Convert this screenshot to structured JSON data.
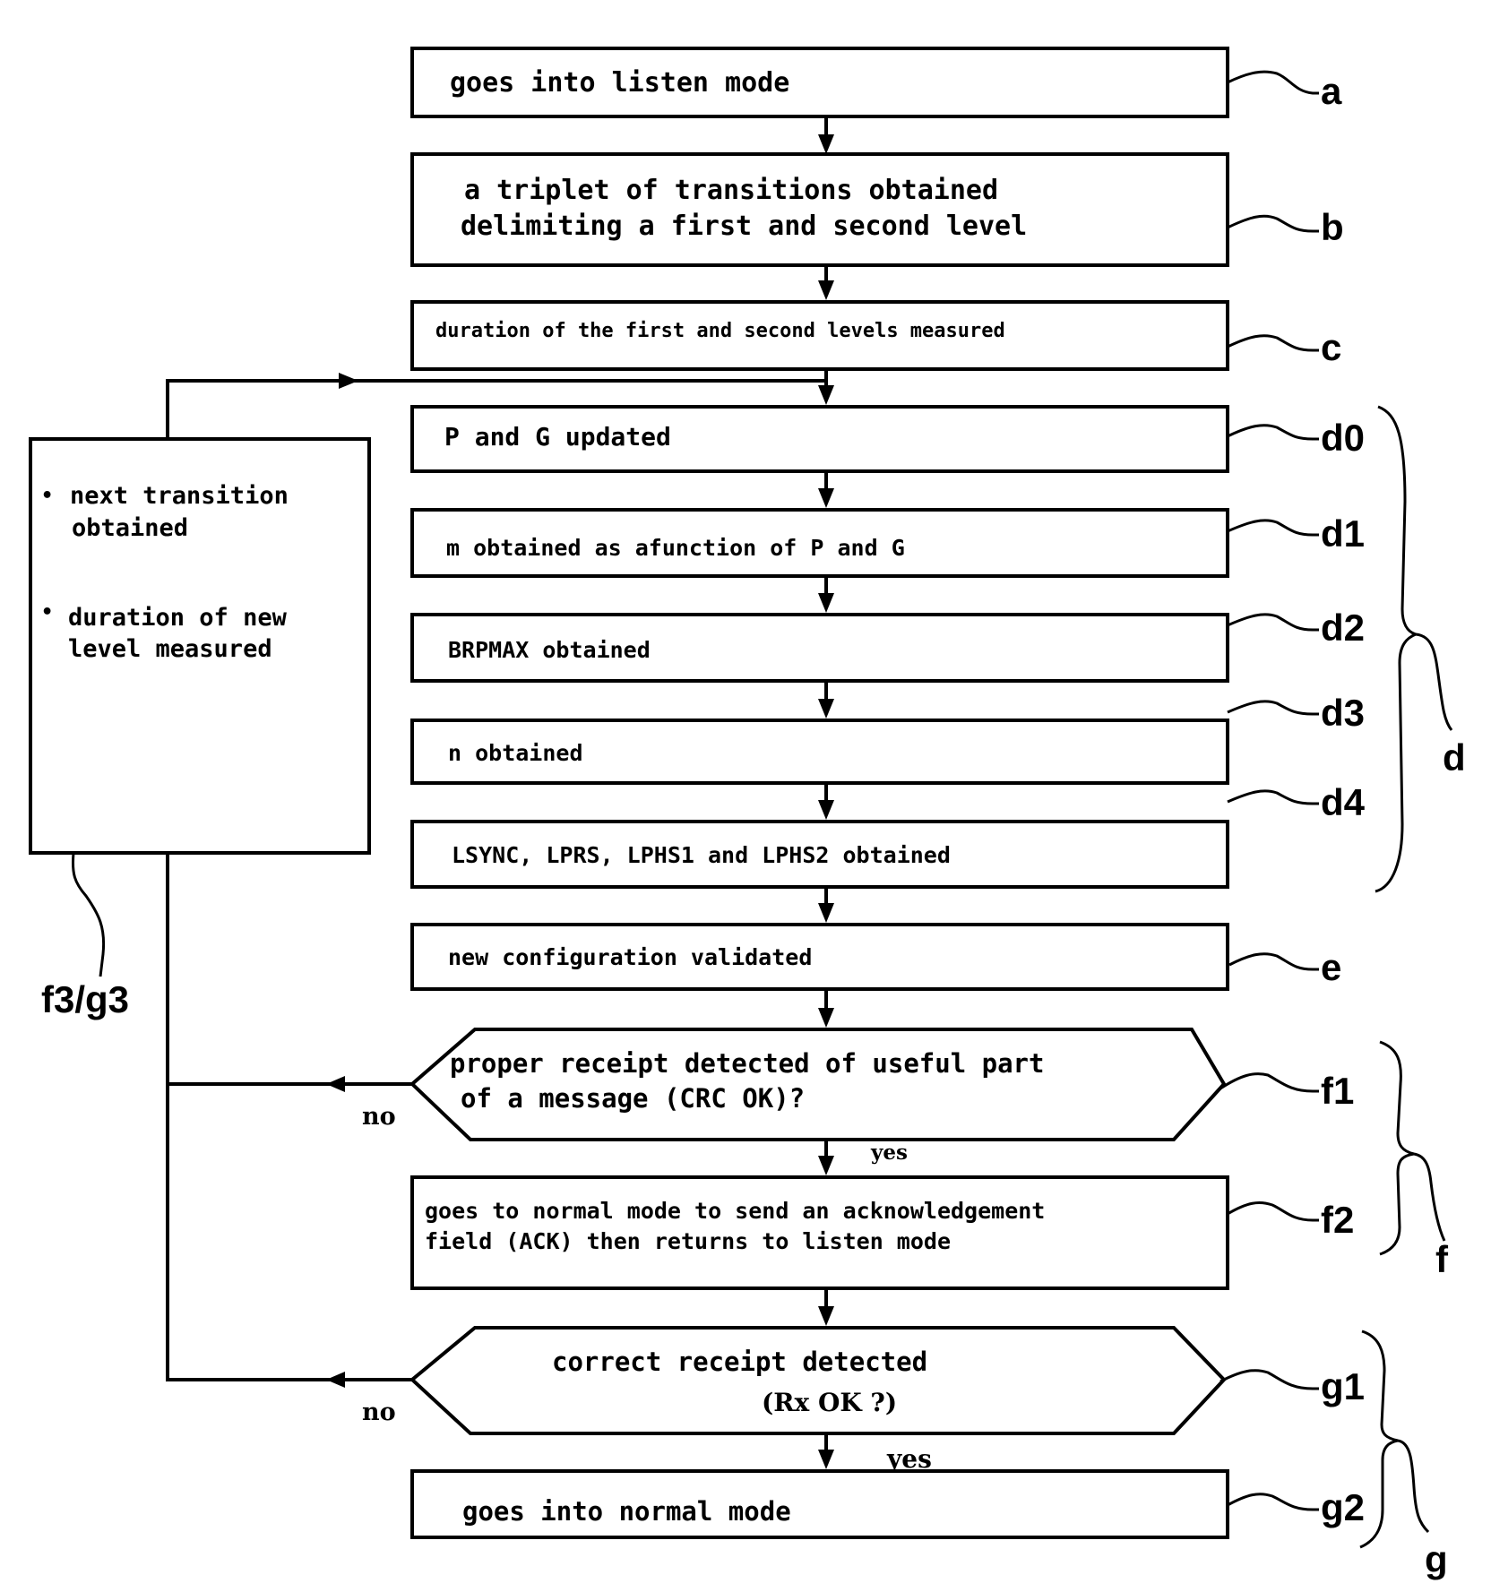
{
  "diagram": {
    "type": "flowchart",
    "steps": [
      {
        "id": "a",
        "lines": [
          "goes into listen mode"
        ]
      },
      {
        "id": "b",
        "lines": [
          "a triplet of transitions obtained",
          "delimiting a first and second level"
        ]
      },
      {
        "id": "c",
        "lines": [
          "duration of the first and second levels measured"
        ]
      },
      {
        "id": "d0",
        "lines": [
          "P and G updated"
        ]
      },
      {
        "id": "d1",
        "lines": [
          "m obtained as afunction of P and G"
        ]
      },
      {
        "id": "d2",
        "lines": [
          "BRPMAX obtained"
        ]
      },
      {
        "id": "d3",
        "lines": [
          "n obtained"
        ]
      },
      {
        "id": "d4",
        "lines": [
          "LSYNC, LPRS, LPHS1 and LPHS2 obtained"
        ]
      },
      {
        "id": "e",
        "lines": [
          "new configuration validated"
        ]
      },
      {
        "id": "f1",
        "lines": [
          "proper receipt detected of useful part",
          "of a message (CRC OK)?"
        ]
      },
      {
        "id": "f2",
        "lines": [
          "goes to normal mode to send an acknowledgement",
          "field (ACK) then returns to listen mode"
        ]
      },
      {
        "id": "g1",
        "lines": [
          "correct receipt detected",
          "(Rx OK ?)"
        ]
      },
      {
        "id": "g2",
        "lines": [
          "goes into normal mode"
        ]
      }
    ],
    "loop_box": {
      "id": "f3/g3",
      "bullets": [
        [
          "next transition",
          "obtained"
        ],
        [
          "duration of new",
          "level measured"
        ]
      ],
      "bullet_symbol": "•"
    },
    "refs": {
      "a": "a",
      "b": "b",
      "c": "c",
      "d0": "d0",
      "d1": "d1",
      "d2": "d2",
      "d3": "d3",
      "d4": "d4",
      "e": "e",
      "f1": "f1",
      "f2": "f2",
      "g1": "g1",
      "g2": "g2",
      "loop": "f3/g3"
    },
    "groups": [
      {
        "label": "d",
        "members": [
          "d0",
          "d1",
          "d2",
          "d3",
          "d4"
        ]
      },
      {
        "label": "f",
        "members": [
          "f1",
          "f2"
        ]
      },
      {
        "label": "g",
        "members": [
          "g1",
          "g2"
        ]
      }
    ],
    "branches": {
      "f1_yes": "yes",
      "f1_no": "no",
      "g1_yes": "yes",
      "g1_no": "no"
    }
  }
}
